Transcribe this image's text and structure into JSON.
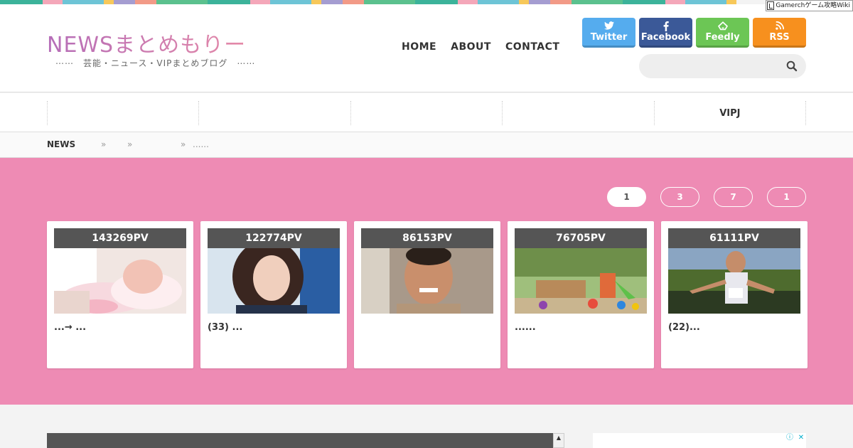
{
  "top_stripe_colors": [
    "#3cb39a",
    "#f4a7b9",
    "#6dc4d6",
    "#f7c85a",
    "#a59dd1",
    "#f29a87",
    "#5bc18e",
    "#3cb39a",
    "#f4a7b9",
    "#6dc4d6",
    "#f7c85a",
    "#a59dd1",
    "#f29a87",
    "#5bc18e",
    "#3cb39a",
    "#f4a7b9",
    "#6dc4d6",
    "#f7c85a",
    "#a59dd1",
    "#f29a87",
    "#5bc18e",
    "#3cb39a",
    "#f4a7b9",
    "#6dc4d6",
    "#f7c85a"
  ],
  "gamerch": {
    "label": "Gamerchゲーム攻略Wiki"
  },
  "site": {
    "title": "NEWSまとめもりー",
    "tagline": "⋯⋯　芸能・ニュース・VIPまとめブログ　⋯⋯"
  },
  "nav": {
    "home": "HOME",
    "about": "ABOUT",
    "contact": "CONTACT"
  },
  "sns": {
    "twitter": "Twitter",
    "facebook": "Facebook",
    "feedly": "Feedly",
    "rss": "RSS"
  },
  "search": {
    "placeholder": ""
  },
  "categories": [
    "",
    "",
    "",
    "",
    "VIPJ"
  ],
  "breadcrumb": {
    "home": "NEWS",
    "sep": "»",
    "current": "......"
  },
  "ranking_tabs": [
    "1",
    "3",
    "7",
    "1"
  ],
  "cards": [
    {
      "pv": "143269PV",
      "title": "...→ ...",
      "image": "baby-photo"
    },
    {
      "pv": "122774PV",
      "title": "(33) ...",
      "image": "woman-portrait-photo"
    },
    {
      "pv": "86153PV",
      "title": "",
      "image": "man-portrait-photo"
    },
    {
      "pv": "76705PV",
      "title": "......",
      "image": "playground-photo"
    },
    {
      "pv": "61111PV",
      "title": "(22)...",
      "image": "runner-photo"
    }
  ],
  "colors": {
    "accent_pink": "#ee8bb4",
    "twitter": "#55acee",
    "facebook": "#3b5998",
    "feedly": "#6cc655",
    "rss": "#f7901e",
    "pv_bar": "#555555"
  }
}
